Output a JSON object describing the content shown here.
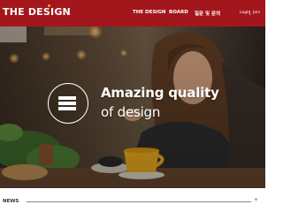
{
  "header": {
    "logo": "THE DESIGN",
    "nav": [
      "THE DESIGN",
      "BOARD",
      "질문 및 문의"
    ],
    "utility": {
      "login": "Login",
      "join": "Join"
    }
  },
  "hero": {
    "title": "Amazing quality",
    "subtitle": "of design",
    "icon": "stacked-lines-icon"
  },
  "news": {
    "label": "NEWS",
    "more": "+"
  },
  "colors": {
    "header_bg": "#a2161c",
    "logo_accent": "#f5a623",
    "text_light": "#ffffff"
  }
}
